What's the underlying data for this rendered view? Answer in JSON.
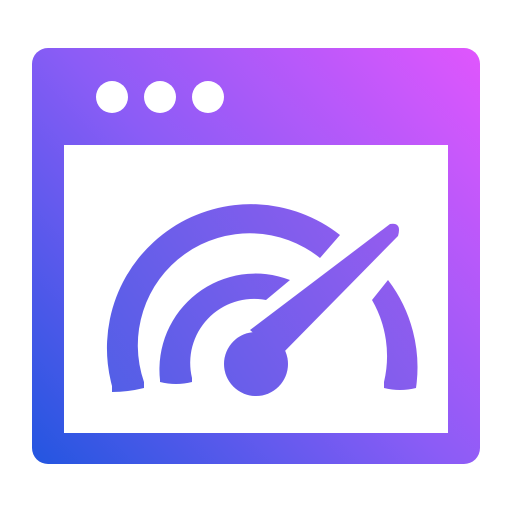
{
  "icon": {
    "name": "browser-speedometer-icon",
    "window_dots": 3,
    "gradient": {
      "start_color": "#2356e0",
      "end_color": "#e056fd",
      "mid_color": "#8b5cf6"
    },
    "background_color": "#ffffff"
  }
}
